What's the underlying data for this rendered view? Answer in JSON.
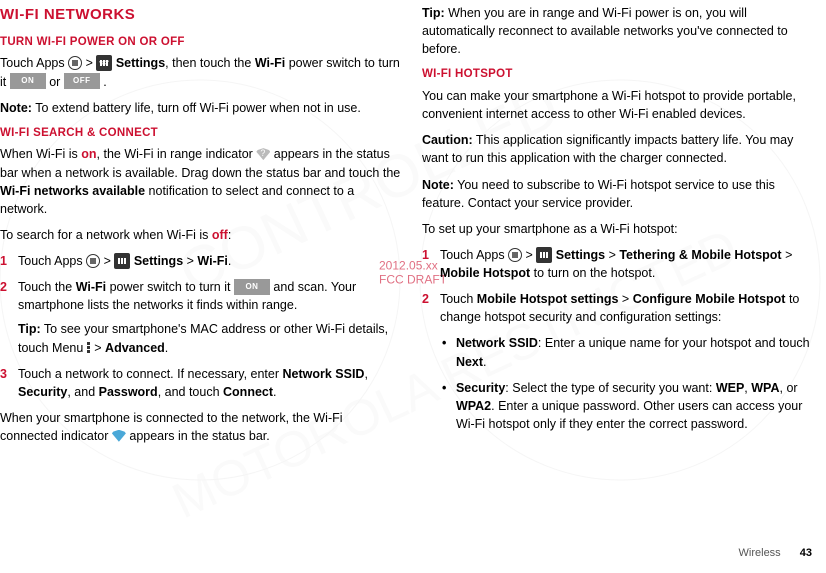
{
  "draft": {
    "date": "2012.05.xx",
    "label": "FCC DRAFT"
  },
  "left": {
    "h1": "Wi-Fi networks",
    "sec1_h": "Turn Wi-Fi power on or off",
    "sec1_p1a": "Touch Apps ",
    "sec1_p1b": " > ",
    "sec1_p1c": " Settings",
    "sec1_p1d": ", then touch the ",
    "sec1_p1e": "Wi-Fi",
    "sec1_p1f": " power switch to turn it ",
    "on": "ON",
    "sec1_p1g": " or ",
    "off": "OFF",
    "sec1_p1h": " .",
    "sec1_note_l": "Note:",
    "sec1_note": " To extend battery life, turn off Wi-Fi power when not in use.",
    "sec2_h": "Wi-Fi search & connect",
    "sec2_p1a": "When Wi-Fi is ",
    "sec2_on": "on",
    "sec2_p1b": ", the Wi-Fi in range indicator ",
    "sec2_p1c": " appears in the status bar when a network is available. Drag down the status bar and touch the ",
    "sec2_p1d": "Wi-Fi networks available",
    "sec2_p1e": " notification to select and connect to a network.",
    "sec2_p2a": "To search for a network when Wi-Fi is ",
    "sec2_off": "off",
    "sec2_p2b": ":",
    "li1a": "Touch Apps ",
    "li1b": " > ",
    "li1c": " Settings",
    "li1d": " > ",
    "li1e": "Wi-Fi",
    "li1f": ".",
    "li2a": "Touch the ",
    "li2b": "Wi-Fi",
    "li2c": " power switch to turn it ",
    "li2d": " and scan. Your smartphone lists the networks it finds within range.",
    "li2_tip_l": "Tip:",
    "li2_tip": " To see your smartphone's MAC address or other Wi-Fi details, touch Menu ",
    "li2_tip2": " > ",
    "li2_tip3": "Advanced",
    "li2_tip4": ".",
    "li3a": "Touch a network to connect. If necessary, enter ",
    "li3b": "Network SSID",
    "li3c": ", ",
    "li3d": "Security",
    "li3e": ", and ",
    "li3f": "Password",
    "li3g": ", and touch ",
    "li3h": "Connect",
    "li3i": ".",
    "sec2_p3a": "When your smartphone is connected to the network, the Wi-Fi connected indicator ",
    "sec2_p3b": " appears in the status bar."
  },
  "right": {
    "tip_l": "Tip:",
    "tip": " When you are in range and Wi-Fi power is on, you will automatically reconnect to available networks you've connected to before.",
    "sec_h": "Wi-Fi hotspot",
    "p1": "You can make your smartphone a Wi-Fi hotspot to provide portable, convenient internet access to other Wi-Fi enabled devices.",
    "caution_l": "Caution:",
    "caution": " This application significantly impacts battery life. You may want to run this application with the charger connected.",
    "note_l": "Note:",
    "note": " You need to subscribe to Wi-Fi hotspot service to use this feature. Contact your service provider.",
    "p2": "To set up your smartphone as a Wi-Fi hotspot:",
    "li1a": "Touch Apps ",
    "li1b": " > ",
    "li1c": " Settings",
    "li1d": " > ",
    "li1e": "Tethering & Mobile Hotspot",
    "li1f": " > ",
    "li1g": "Mobile Hotspot",
    "li1h": " to turn on the hotspot.",
    "li2a": "Touch ",
    "li2b": "Mobile Hotspot settings",
    "li2c": " > ",
    "li2d": "Configure Mobile Hotspot",
    "li2e": " to change hotspot security and configuration settings:",
    "b1a": "Network SSID",
    "b1b": ": Enter a unique name for your hotspot and touch ",
    "b1c": "Next",
    "b1d": ".",
    "b2a": "Security",
    "b2b": ": Select the type of security you want: ",
    "b2c": "WEP",
    "b2d": ", ",
    "b2e": "WPA",
    "b2f": ", or ",
    "b2g": "WPA2",
    "b2h": ". Enter a unique password. Other users can access your Wi-Fi hotspot only if they enter the correct password."
  },
  "footer": {
    "section": "Wireless",
    "page": "43"
  }
}
